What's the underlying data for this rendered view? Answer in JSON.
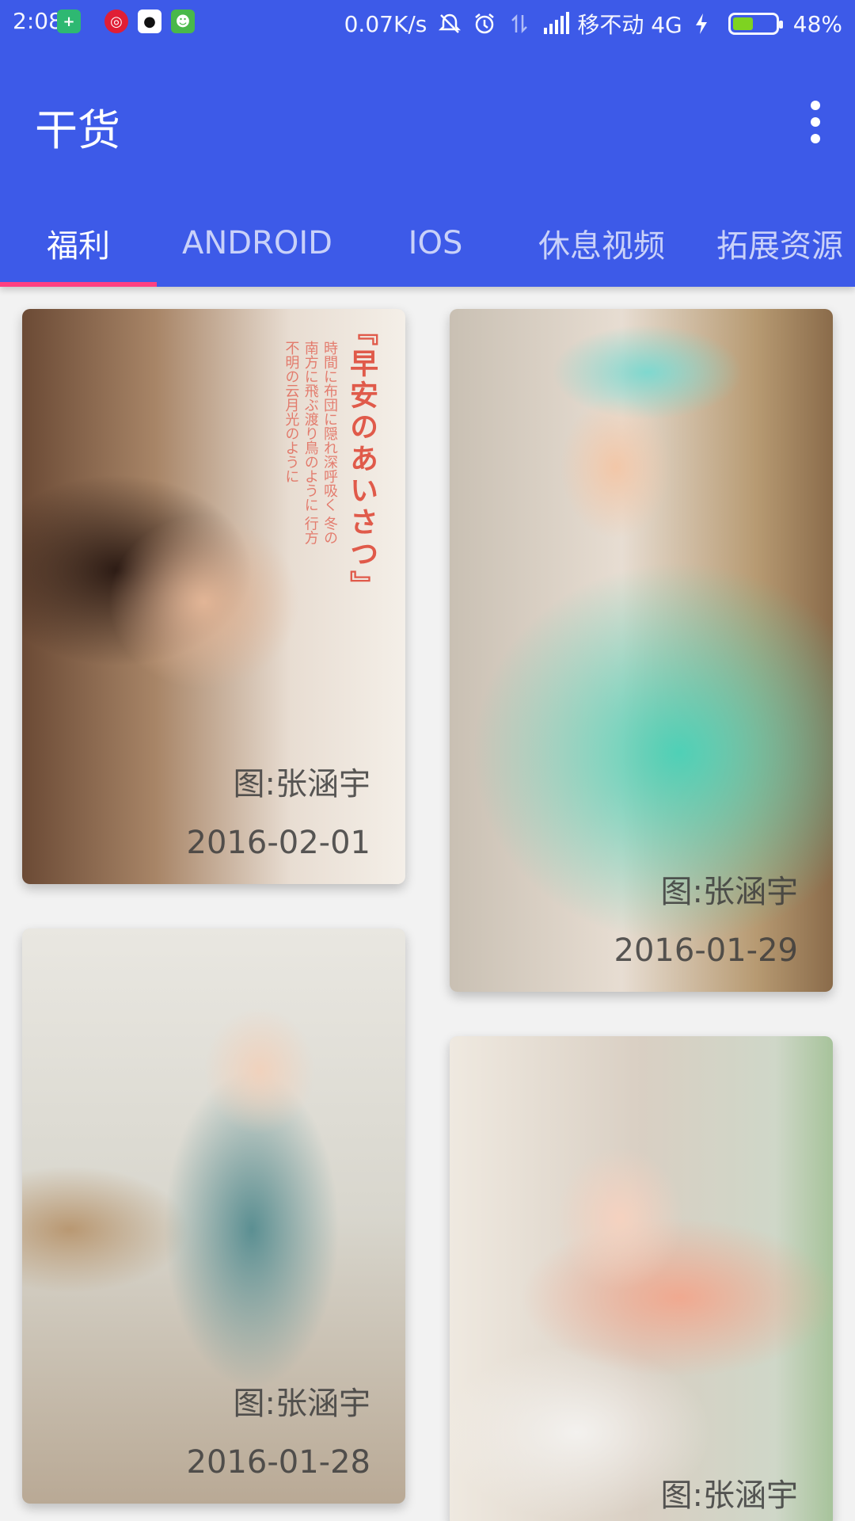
{
  "status_bar": {
    "time": "2:08",
    "net_speed": "0.07K/s",
    "carrier": "移不动 4G",
    "battery_percent": "48%",
    "battery_level": 0.48,
    "notification_icons": [
      "shield-icon",
      "netease-music-icon",
      "qq-icon",
      "frog-icon"
    ],
    "status_icons": [
      "mute-icon",
      "alarm-icon",
      "data-arrows-icon",
      "signal-icon",
      "charging-icon"
    ]
  },
  "toolbar": {
    "title": "干货",
    "overflow_icon": "more-vert-icon"
  },
  "tabs": [
    {
      "label": "福利",
      "active": true
    },
    {
      "label": "ANDROID",
      "active": false
    },
    {
      "label": "IOS",
      "active": false
    },
    {
      "label": "休息视频",
      "active": false
    },
    {
      "label": "拓展资源",
      "active": false
    }
  ],
  "cards": [
    {
      "credit": "图:张涵宇",
      "date": "2016-02-01",
      "overlay_title": "『早安のあいさつ』",
      "overlay_text": "時間に布団に隠れ深呼吸く 冬の南方に飛ぶ渡り鳥のように 行方不明の云月光のように"
    },
    {
      "credit": "图:张涵宇",
      "date": "2016-01-29"
    },
    {
      "credit": "图:张涵宇",
      "date": "2016-01-28"
    },
    {
      "credit": "图:张涵宇",
      "date": ""
    }
  ],
  "colors": {
    "primary": "#3d5ae8",
    "accent": "#ff4081",
    "background": "#f2f2f2"
  }
}
